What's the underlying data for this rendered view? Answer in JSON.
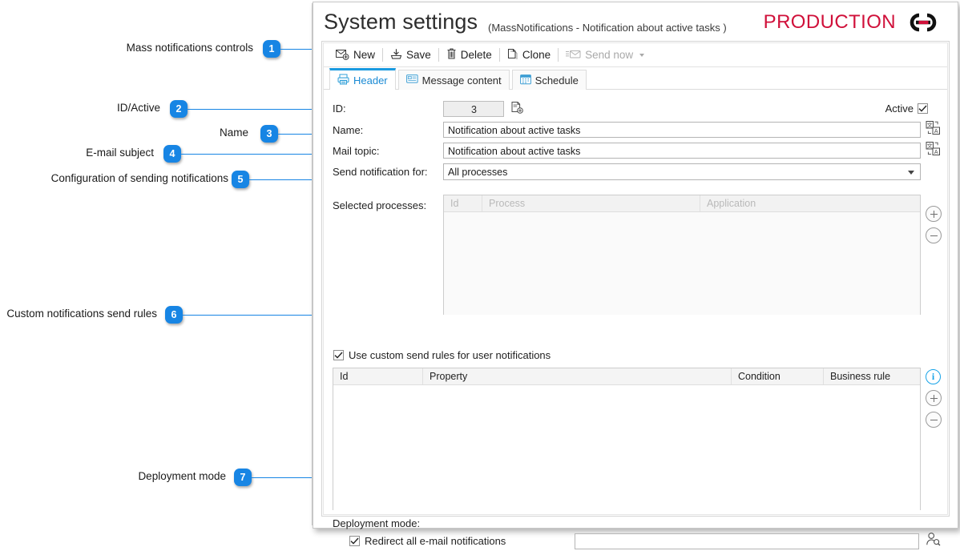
{
  "annotations": [
    {
      "num": "1",
      "label": "Mass notifications controls"
    },
    {
      "num": "2",
      "label": "ID/Active"
    },
    {
      "num": "3",
      "label": "Name"
    },
    {
      "num": "4",
      "label": "E-mail subject"
    },
    {
      "num": "5",
      "label": "Configuration of sending notifications"
    },
    {
      "num": "6",
      "label": "Custom notifications send rules"
    },
    {
      "num": "7",
      "label": "Deployment mode"
    }
  ],
  "window": {
    "title": "System settings",
    "subtitle": "(MassNotifications - Notification about active tasks )",
    "logo_text": "PRODUCTION",
    "logo_color": "#d0103a",
    "accent_color": "#1a9ae0"
  },
  "toolbar": {
    "new_label": "New",
    "save_label": "Save",
    "delete_label": "Delete",
    "clone_label": "Clone",
    "send_now_label": "Send now"
  },
  "tabs": [
    {
      "label": "Header",
      "icon": "header-printer-icon",
      "active": true
    },
    {
      "label": "Message content",
      "icon": "message-card-icon",
      "active": false
    },
    {
      "label": "Schedule",
      "icon": "calendar-icon",
      "active": false
    }
  ],
  "form": {
    "id_label": "ID:",
    "id_value": "3",
    "active_label": "Active",
    "active_checked": true,
    "name_label": "Name:",
    "name_value": "Notification about active tasks",
    "mail_topic_label": "Mail topic:",
    "mail_topic_value": "Notification about active tasks",
    "send_for_label": "Send notification for:",
    "send_for_value": "All processes",
    "selected_processes_label": "Selected processes:",
    "processes_columns": [
      "Id",
      "Process",
      "Application"
    ],
    "processes_rows": [],
    "custom_rules_label": "Use custom send rules for user notifications",
    "custom_rules_checked": true,
    "rules_columns": [
      "Id",
      "Property",
      "Condition",
      "Business rule"
    ],
    "rules_rows": [],
    "deployment_label": "Deployment mode:",
    "redirect_label": "Redirect all e-mail notifications",
    "redirect_checked": true,
    "redirect_value": "",
    "redirect_placeholder": ""
  }
}
